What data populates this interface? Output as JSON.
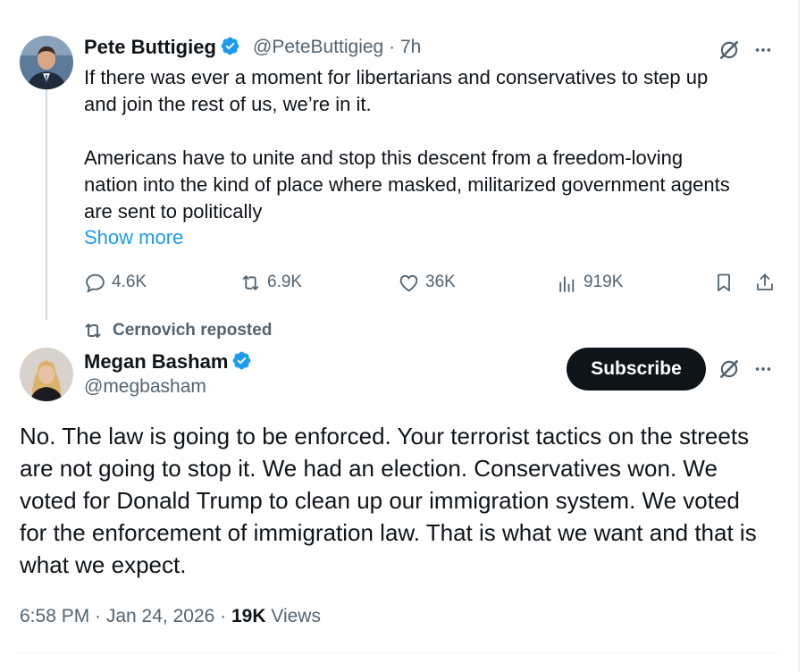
{
  "post1": {
    "author_name": "Pete Buttigieg",
    "handle": "@PeteButtigieg",
    "separator": "·",
    "time": "7h",
    "text_line1": "If there was ever a moment for libertarians and conservatives to step up",
    "text_line2": "and join the rest of us, we’re in it.",
    "text_line3": "Americans have to unite and stop this descent from a freedom-loving",
    "text_line4": "nation into the kind of place where masked, militarized government agents",
    "text_line5": "are sent to politically",
    "show_more": "Show more",
    "stats": {
      "replies": "4.6K",
      "reposts": "6.9K",
      "likes": "36K",
      "views": "919K"
    }
  },
  "repost_banner": "Cernovich reposted",
  "post2": {
    "author_name": "Megan Basham",
    "handle": "@megbasham",
    "subscribe_label": "Subscribe",
    "text_line1": "No. The law is going to be enforced. Your terrorist tactics on the streets",
    "text_line2": "are not going to stop it. We had an election. Conservatives won. We",
    "text_line3": "voted for Donald Trump to clean up our immigration system. We voted",
    "text_line4": "for the enforcement of immigration law. That is what we want and that is",
    "text_line5": "what we expect.",
    "timestamp": "6:58 PM · Jan 24, 2026 · ",
    "view_count": "19K",
    "views_label": " Views"
  },
  "colors": {
    "accent": "#1d9bf0",
    "muted": "#536471",
    "text": "#0f1419",
    "verified": "#1d9bf0"
  },
  "icons": [
    "verified-badge-icon",
    "grok-icon",
    "more-icon",
    "reply-icon",
    "repost-icon",
    "like-icon",
    "views-icon",
    "bookmark-icon",
    "share-icon"
  ]
}
